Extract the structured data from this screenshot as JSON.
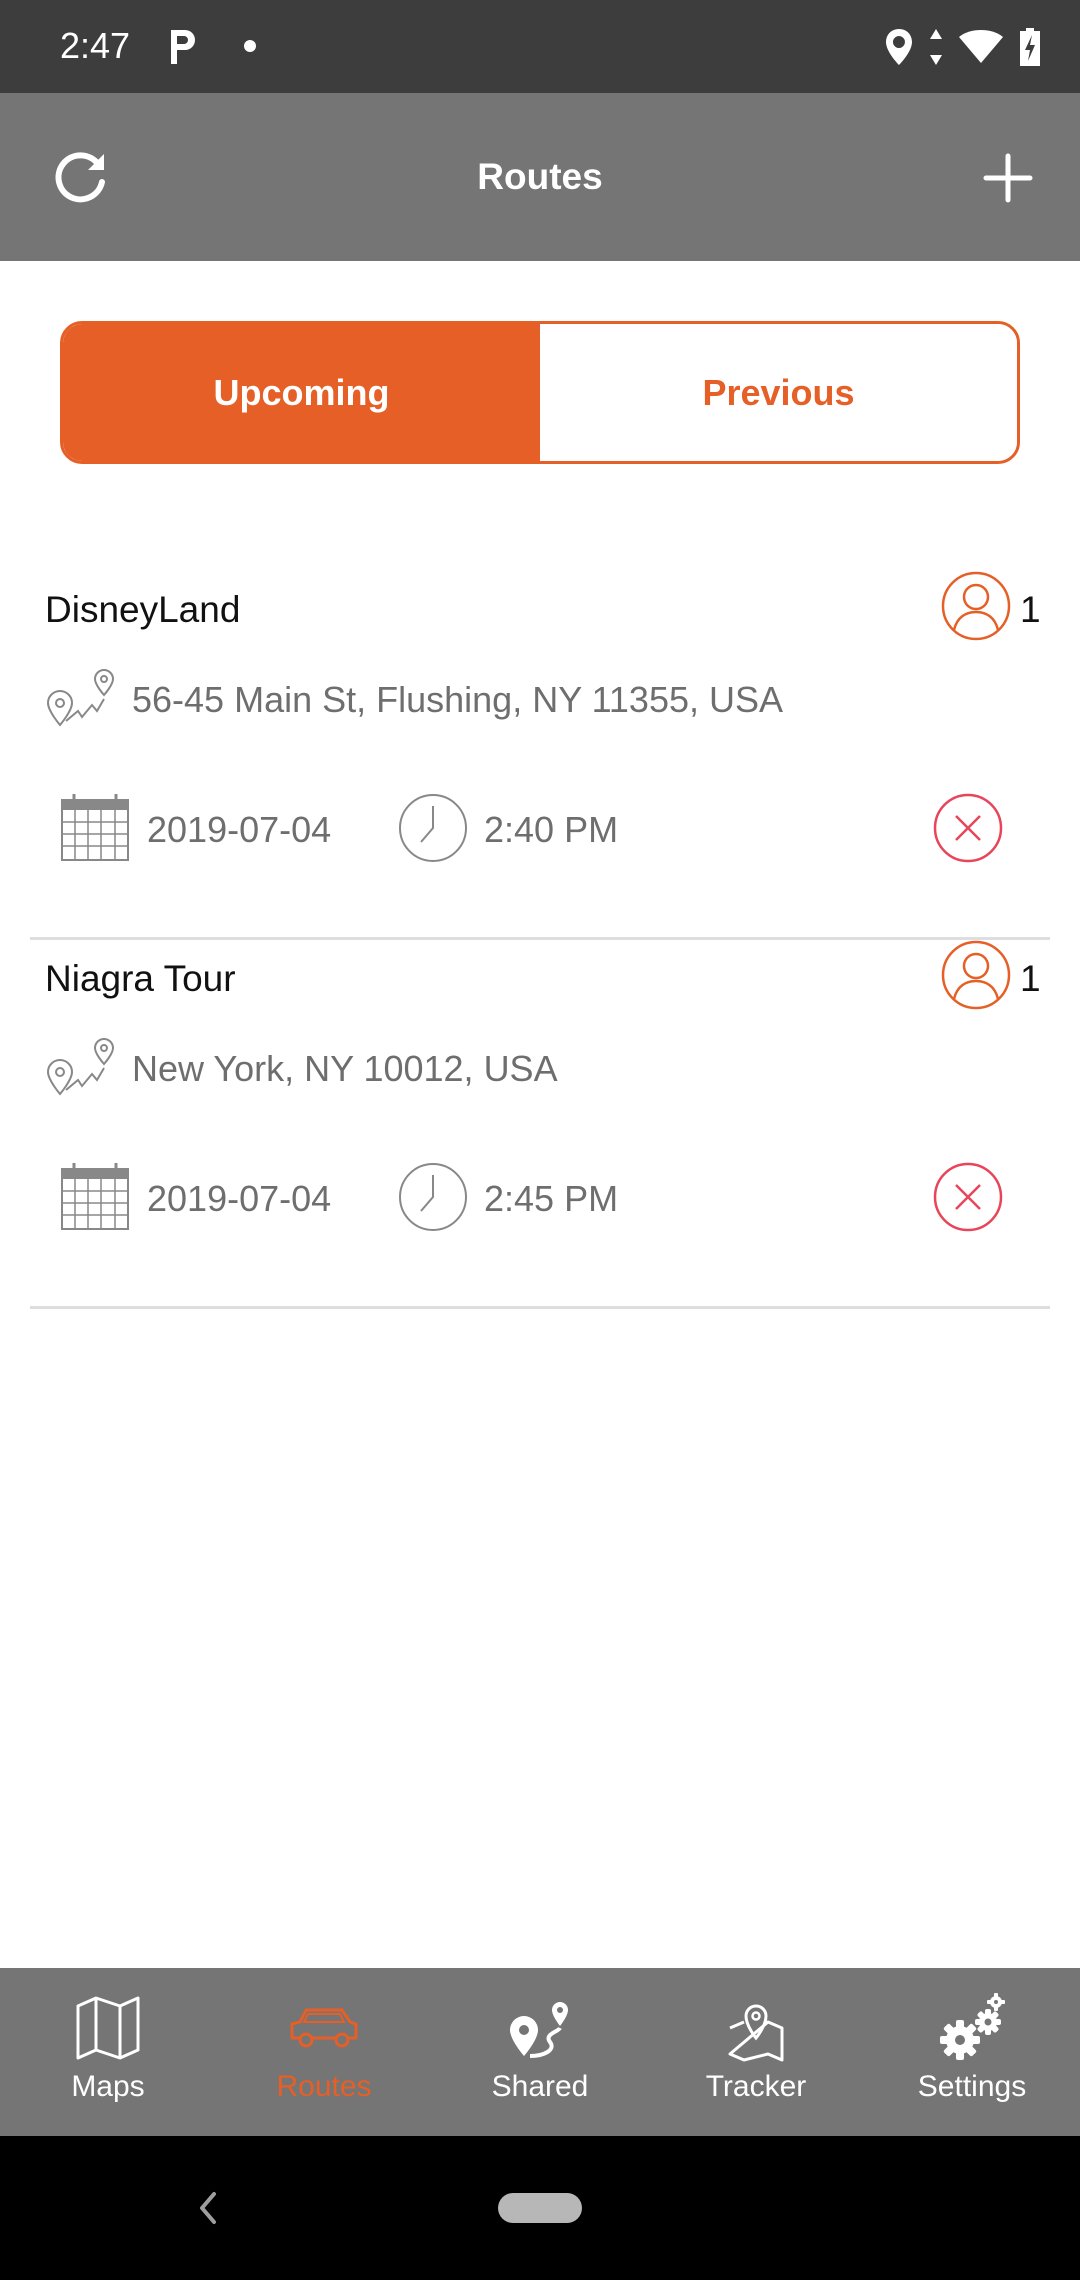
{
  "status_bar": {
    "time": "2:47",
    "icons": [
      "parking-icon",
      "notification-dot-icon",
      "location-icon",
      "data-arrows-icon",
      "wifi-icon",
      "battery-charging-icon"
    ]
  },
  "app_bar": {
    "title": "Routes",
    "left_icon": "refresh-icon",
    "right_icon": "plus-icon"
  },
  "segments": {
    "upcoming": "Upcoming",
    "previous": "Previous",
    "active": "upcoming"
  },
  "routes": [
    {
      "name": "DisneyLand",
      "member_count": "1",
      "address": "56-45 Main St, Flushing, NY 11355, USA",
      "date": "2019-07-04",
      "time": "2:40 PM"
    },
    {
      "name": "Niagra Tour",
      "member_count": "1",
      "address": "New York, NY 10012, USA",
      "date": "2019-07-04",
      "time": "2:45 PM"
    }
  ],
  "bottom_nav": {
    "tabs": [
      {
        "label": "Maps",
        "icon": "map-icon"
      },
      {
        "label": "Routes",
        "icon": "car-icon"
      },
      {
        "label": "Shared",
        "icon": "shared-route-icon"
      },
      {
        "label": "Tracker",
        "icon": "tracker-icon"
      },
      {
        "label": "Settings",
        "icon": "gears-icon"
      }
    ],
    "active": "Routes"
  },
  "colors": {
    "accent": "#e55f27",
    "app_bar": "#757575",
    "status_bar": "#3d3d3d",
    "delete": "#e8455a"
  }
}
